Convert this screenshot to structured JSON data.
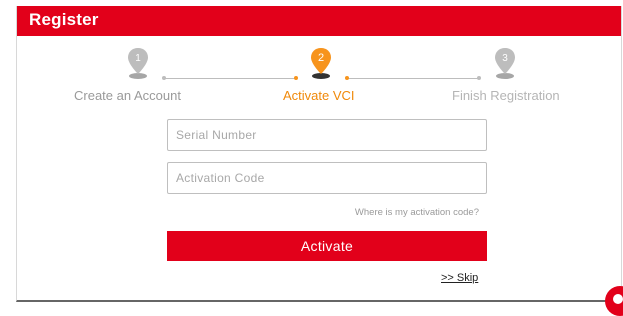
{
  "window": {
    "title": "Register"
  },
  "steps": [
    {
      "number": "1",
      "label": "Create an Account",
      "state": "done"
    },
    {
      "number": "2",
      "label": "Activate VCI",
      "state": "active"
    },
    {
      "number": "3",
      "label": "Finish Registration",
      "state": "pending"
    }
  ],
  "form": {
    "serial_number": {
      "value": "",
      "placeholder": "Serial Number"
    },
    "activation_code": {
      "value": "",
      "placeholder": "Activation Code"
    },
    "help_link": "Where is my activation code?",
    "activate_label": "Activate",
    "skip_label": ">> Skip"
  },
  "colors": {
    "brand_red": "#e2001a",
    "active_orange": "#f7941d",
    "inactive_gray": "#9a9a9a"
  },
  "icons": [
    "step-pin-icon",
    "corner-badge-icon"
  ]
}
